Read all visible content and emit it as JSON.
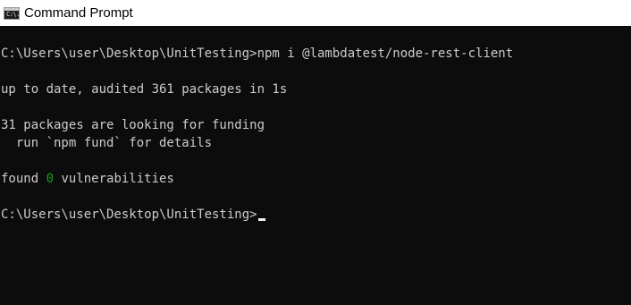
{
  "window": {
    "title": "Command Prompt",
    "icon": "cmd-icon",
    "icon_label": "C:\\."
  },
  "console": {
    "colors": {
      "background": "#0c0c0c",
      "text": "#cccccc",
      "highlight": "#13a10e"
    },
    "command_line": "C:\\Users\\user\\Desktop\\UnitTesting>npm i @lambdatest/node-rest-client",
    "audit_line": "up to date, audited 361 packages in 1s",
    "funding_line": "31 packages are looking for funding",
    "fund_hint_line": "  run `npm fund` for details",
    "found_prefix": "found ",
    "vulnerability_count": "0",
    "found_suffix": " vulnerabilities",
    "prompt": "C:\\Users\\user\\Desktop\\UnitTesting>"
  }
}
